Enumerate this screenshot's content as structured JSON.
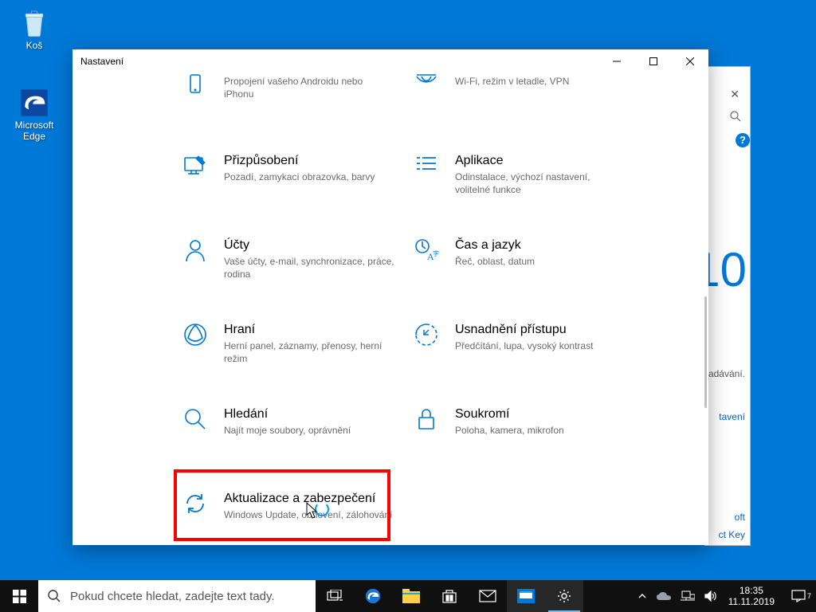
{
  "desktop": {
    "recycle_label": "Koš",
    "edge_label": "Microsoft Edge"
  },
  "background_window": {
    "big_text": "10",
    "snippet1": "adávání.",
    "link1": "tavení",
    "link2": "oft",
    "link3": "ct Key"
  },
  "settings_window": {
    "title": "Nastavení",
    "categories": {
      "phone": {
        "title": "",
        "desc": "Propojení vašeho Androidu nebo iPhonu"
      },
      "network": {
        "title": "",
        "desc": "Wi-Fi, režim v letadle, VPN"
      },
      "personalization": {
        "title": "Přizpůsobení",
        "desc": "Pozadí, zamykací obrazovka, barvy"
      },
      "apps": {
        "title": "Aplikace",
        "desc": "Odinstalace, výchozí nastavení, volitelné funkce"
      },
      "accounts": {
        "title": "Účty",
        "desc": "Vaše účty, e-mail, synchronizace, práce, rodina"
      },
      "time": {
        "title": "Čas a jazyk",
        "desc": "Řeč, oblast, datum"
      },
      "gaming": {
        "title": "Hraní",
        "desc": "Herní panel, záznamy, přenosy, herní režim"
      },
      "ease": {
        "title": "Usnadnění přístupu",
        "desc": "Předčítání, lupa, vysoký kontrast"
      },
      "search": {
        "title": "Hledání",
        "desc": "Najít moje soubory, oprávnění"
      },
      "privacy": {
        "title": "Soukromí",
        "desc": "Poloha, kamera, mikrofon"
      },
      "update": {
        "title": "Aktualizace a zabezpečení",
        "desc": "Windows Update, obnovení, zálohování"
      }
    }
  },
  "taskbar": {
    "search_placeholder": "Pokud chcete hledat, zadejte text tady.",
    "time": "18:35",
    "date": "11.11.2019",
    "notif_count": "7"
  }
}
